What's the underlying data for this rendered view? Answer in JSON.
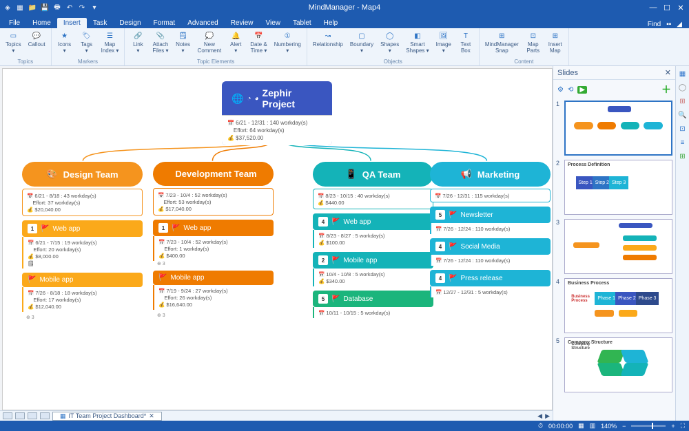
{
  "app": {
    "title": "MindManager - Map4"
  },
  "menubar": {
    "tabs": [
      "File",
      "Home",
      "Insert",
      "Task",
      "Design",
      "Format",
      "Advanced",
      "Review",
      "View",
      "Tablet",
      "Help"
    ],
    "active_index": 2,
    "find_label": "Find"
  },
  "ribbon": {
    "groups": [
      {
        "name": "Topics",
        "items": [
          {
            "label": "Topics\n▾",
            "icon": "topic"
          },
          {
            "label": "Callout",
            "icon": "callout"
          }
        ]
      },
      {
        "name": "Markers",
        "items": [
          {
            "label": "Icons\n▾",
            "icon": "star"
          },
          {
            "label": "Tags\n▾",
            "icon": "tag"
          },
          {
            "label": "Map\nIndex ▾",
            "icon": "index"
          }
        ]
      },
      {
        "name": "Topic Elements",
        "items": [
          {
            "label": "Link\n▾",
            "icon": "link"
          },
          {
            "label": "Attach\nFiles ▾",
            "icon": "attach"
          },
          {
            "label": "Notes\n▾",
            "icon": "notes"
          },
          {
            "label": "New\nComment",
            "icon": "comment"
          },
          {
            "label": "Alert\n▾",
            "icon": "alert"
          },
          {
            "label": "Date &\nTime ▾",
            "icon": "date"
          },
          {
            "label": "Numbering\n▾",
            "icon": "number"
          }
        ]
      },
      {
        "name": "Objects",
        "items": [
          {
            "label": "Relationship",
            "icon": "rel"
          },
          {
            "label": "Boundary\n▾",
            "icon": "boundary"
          },
          {
            "label": "Shapes\n▾",
            "icon": "shapes"
          },
          {
            "label": "Smart\nShapes ▾",
            "icon": "smart"
          },
          {
            "label": "Image\n▾",
            "icon": "image"
          },
          {
            "label": "Text\nBox",
            "icon": "text"
          }
        ]
      },
      {
        "name": "Content",
        "items": [
          {
            "label": "MindManager\nSnap",
            "icon": "snap"
          },
          {
            "label": "Map\nParts",
            "icon": "parts"
          },
          {
            "label": "Insert\nMap",
            "icon": "insertmap"
          }
        ]
      }
    ]
  },
  "map": {
    "root": {
      "title": "Zephir Project",
      "dates": "6/21 - 12/31 : 140 workday(s)",
      "effort": "Effort: 64 workday(s)",
      "cost": "$37,520.00"
    },
    "teams": [
      {
        "name": "Design Team",
        "color": "orange",
        "dates": "6/21 - 8/18 : 43 workday(s)",
        "effort": "Effort: 37 workday(s)",
        "cost": "$20,040.00",
        "tasks": [
          {
            "name": "Web app",
            "badge": "1",
            "color": "yellow",
            "dates": "6/21 - 7/15 : 19 workday(s)",
            "effort": "Effort: 20 workday(s)",
            "cost": "$8,000.00",
            "note": true
          },
          {
            "name": "Mobile app",
            "badge": "",
            "color": "yellow",
            "dates": "7/26 - 8/18 : 18 workday(s)",
            "effort": "Effort: 17 workday(s)",
            "cost": "$12,040.00"
          }
        ],
        "trailing": "3"
      },
      {
        "name": "Development Team",
        "color": "dkorange",
        "dates": "7/23 - 10/4 : 52 workday(s)",
        "effort": "Effort: 53 workday(s)",
        "cost": "$17,040.00",
        "tasks": [
          {
            "name": "Web app",
            "badge": "1",
            "color": "dkorange",
            "dates": "7/23 - 10/4 : 52 workday(s)",
            "effort": "Effort: 1 workday(s)",
            "cost": "$400.00",
            "trailing": "3"
          },
          {
            "name": "Mobile app",
            "badge": "",
            "color": "dkorange",
            "dates": "7/19 - 9/24 : 27 workday(s)",
            "effort": "Effort: 26 workday(s)",
            "cost": "$16,640.00"
          }
        ],
        "trailing": "3"
      },
      {
        "name": "QA Team",
        "color": "teal",
        "dates": "8/23 - 10/15 : 40 workday(s)",
        "cost": "$440.00",
        "tasks": [
          {
            "name": "Web app",
            "badge": "4",
            "color": "teal",
            "dates": "8/23 - 8/27 : 5 workday(s)",
            "cost": "$100.00"
          },
          {
            "name": "Mobile app",
            "badge": "2",
            "color": "teal",
            "dates": "10/4 - 10/8 : 5 workday(s)",
            "cost": "$340.00"
          },
          {
            "name": "Database",
            "badge": "5",
            "color": "green",
            "dates": "10/11 - 10/15 : 5 workday(s)"
          }
        ]
      },
      {
        "name": "Marketing",
        "color": "cyan",
        "dates": "7/26 - 12/31 : 115 workday(s)",
        "tasks": [
          {
            "name": "Newsletter",
            "badge": "5",
            "color": "cyan",
            "dates": "7/26 - 12/24 : 110 workday(s)"
          },
          {
            "name": "Social Media",
            "badge": "4",
            "color": "cyan",
            "dates": "7/26 - 12/24 : 110 workday(s)"
          },
          {
            "name": "Press release",
            "badge": "4",
            "color": "cyan",
            "dates": "12/27 - 12/31 : 5 workday(s)"
          }
        ]
      }
    ]
  },
  "slides": {
    "title": "Slides",
    "items": [
      {
        "label": "1"
      },
      {
        "label": "2",
        "caption": "Process Definition"
      },
      {
        "label": "3"
      },
      {
        "label": "4",
        "caption": "Business Process"
      },
      {
        "label": "5",
        "caption": "Company Structure"
      }
    ]
  },
  "tabstrip": {
    "doc": "IT Team Project Dashboard*"
  },
  "statusbar": {
    "time": "00:00:00",
    "zoom": "140%"
  }
}
